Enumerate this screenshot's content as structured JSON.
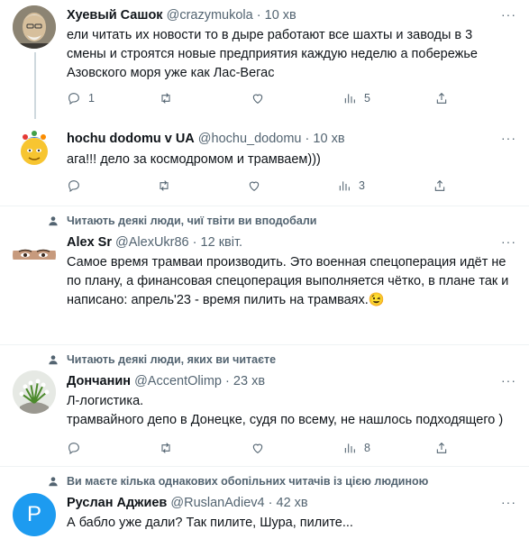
{
  "tweets": [
    {
      "name": "Хуевый Сашок",
      "handle": "@crazymukola",
      "time": "10 хв",
      "text": "ели читать их новости то в дыре работают все шахты и заводы в 3 смены и строятся новые предприятия каждую неделю а побережье Азовского моря уже как Лас-Вегас",
      "replies": "1",
      "retweets": "",
      "likes": "",
      "views": "5"
    },
    {
      "name": "hochu dodomu v UA",
      "handle": "@hochu_dodomu",
      "time": "10 хв",
      "text": "ага!!! дело за космодромом и трамваем)))",
      "replies": "",
      "retweets": "",
      "likes": "",
      "views": "3"
    },
    {
      "context": "Читають деякі люди, чиї твіти ви вподобали",
      "name": "Alex Sr",
      "handle": "@AlexUkr86",
      "time": "12 квіт.",
      "text": "Самое время трамваи производить. Это военная спецоперация идёт не по плану, а финансовая спецоперация выполняется чётко, в плане так и написано: апрель'23 - время пилить на трамваях.",
      "emoji": "😉"
    },
    {
      "context": "Читають деякі люди, яких ви читаєте",
      "name": "Дончанин",
      "handle": "@AccentOlimp",
      "time": "23 хв",
      "text_lines": [
        "Л-логистика.",
        "трамвайного депо в Донецке, судя по всему, не нашлось подходящего )"
      ],
      "replies": "",
      "retweets": "",
      "likes": "",
      "views": "8"
    },
    {
      "context": "Ви маєте кілька однакових обопільних читачів із цією людиною",
      "name": "Руслан Аджиев",
      "handle": "@RuslanAdiev4",
      "time": "42 хв",
      "text": "А бабло уже дали? Так пилите, Шура, пилите...",
      "avatar_letter": "P"
    }
  ],
  "dot": "·",
  "more": "···",
  "colors": {
    "avatar_blue": "#1d9bf0",
    "muted": "#536471"
  }
}
